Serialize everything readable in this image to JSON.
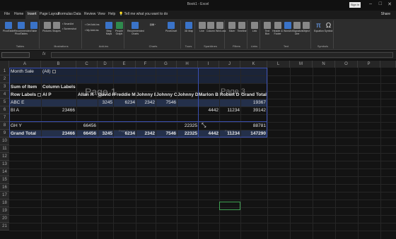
{
  "titlebar": {
    "title": "Book1 - Excel",
    "signin": "Sign in",
    "min": "–",
    "max": "□",
    "close": "✕"
  },
  "tabs": [
    "File",
    "Home",
    "Insert",
    "Page Layout",
    "Formulas",
    "Data",
    "Review",
    "View",
    "Help"
  ],
  "tellme": "Tell me what you want to do",
  "share": "Share",
  "ribbon": {
    "groups": [
      {
        "label": "Tables",
        "buttons": [
          "PivotTable",
          "Recommended PivotTables",
          "Table"
        ]
      },
      {
        "label": "Illustrations",
        "buttons": [
          "Pictures",
          "Shapes",
          "SmartArt",
          "Screenshot"
        ]
      },
      {
        "label": "Add-ins",
        "buttons": [
          "Get Add-ins",
          "My Add-ins",
          "Bing Maps",
          "People Graph"
        ]
      },
      {
        "label": "Charts",
        "buttons": [
          "Recommended Charts",
          "PivotChart"
        ]
      },
      {
        "label": "Tours",
        "buttons": [
          "3D Map"
        ]
      },
      {
        "label": "Sparklines",
        "buttons": [
          "Line",
          "Column",
          "Win/Loss"
        ]
      },
      {
        "label": "Filters",
        "buttons": [
          "Slicer",
          "Timeline"
        ]
      },
      {
        "label": "Links",
        "buttons": [
          "Link"
        ]
      },
      {
        "label": "Text",
        "buttons": [
          "Text Box",
          "Header & Footer",
          "WordArt",
          "Signature Line",
          "Object"
        ]
      },
      {
        "label": "Symbols",
        "buttons": [
          "Equation",
          "Symbol"
        ]
      }
    ]
  },
  "columns": [
    "A",
    "B",
    "C",
    "D",
    "E",
    "F",
    "G",
    "H",
    "I",
    "J",
    "K",
    "L",
    "M",
    "N",
    "O",
    "P"
  ],
  "rows": [
    "1",
    "2",
    "3",
    "4",
    "5",
    "6",
    "7",
    "8",
    "9",
    "10",
    "11",
    "12",
    "13",
    "14",
    "15",
    "16",
    "17",
    "18",
    "19",
    "20",
    "21"
  ],
  "pivot": {
    "filter_label": "Month Sale",
    "filter_value": "(All)",
    "sum_label": "Sum of Item",
    "col_labels": "Column Labels",
    "row_labels": "Row Labels",
    "headers": [
      "Al P",
      "Allan R",
      "David B",
      "Freddie M",
      "Johnny B",
      "Johnny C",
      "Johnny D",
      "Marlon B",
      "Robert D",
      "Grand Total"
    ],
    "data_rows": [
      {
        "label": "ABC E",
        "values": [
          "",
          "",
          "3245",
          "6234",
          "2342",
          "7546",
          "",
          "",
          "",
          "19367"
        ]
      },
      {
        "label": "BI A",
        "values": [
          "23466",
          "",
          "",
          "",
          "",
          "",
          "",
          "4442",
          "11234",
          "39142"
        ]
      },
      {
        "label": "GH Y",
        "values": [
          "",
          "66456",
          "",
          "",
          "",
          "",
          "22325",
          "",
          "",
          "88781"
        ]
      }
    ],
    "total_row": {
      "label": "Grand Total",
      "values": [
        "23466",
        "66456",
        "3245",
        "6234",
        "2342",
        "7546",
        "22325",
        "4442",
        "11234",
        "147290"
      ]
    }
  },
  "pagebreak": {
    "page1": "Page 1",
    "page3": "Page 3",
    "page2": "Page 2",
    "page4": "Page 4"
  }
}
